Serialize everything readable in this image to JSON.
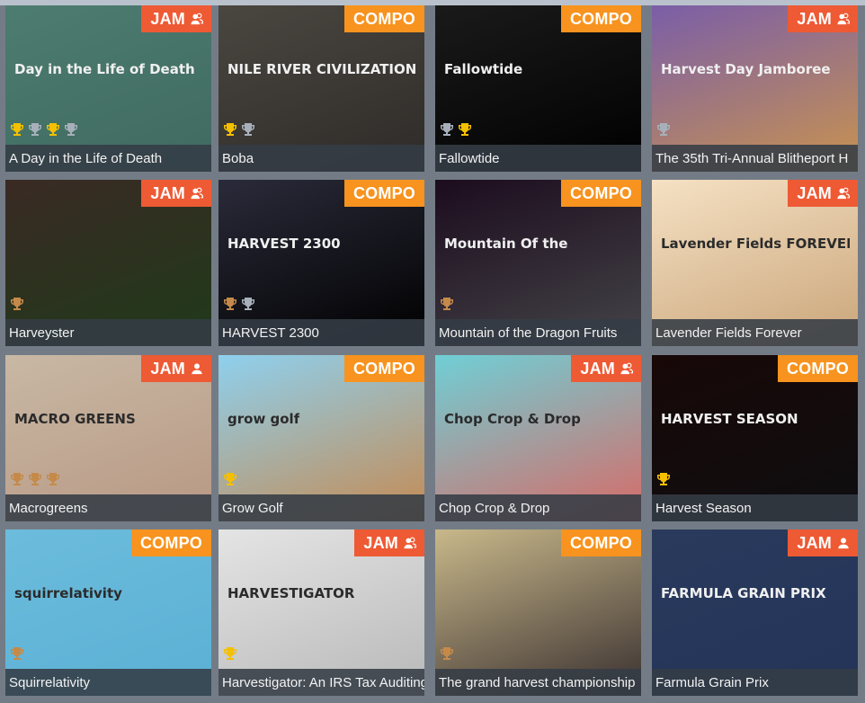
{
  "colors": {
    "background": "#737c86",
    "jam_badge": "#ee5a34",
    "compo_badge": "#f7931e",
    "gold": "#f5c000",
    "silver": "#a7b0ba",
    "bronze": "#c58a4a",
    "title_bar": "#343c46"
  },
  "games": [
    {
      "title": "A Day in the Life of Death",
      "category": "JAM",
      "team": true,
      "trophies": [
        "gold",
        "silver",
        "gold",
        "silver"
      ],
      "art": "Day in the Life of Death",
      "thumb": [
        "#4d7c70",
        "#3f6a60"
      ]
    },
    {
      "title": "Boba",
      "category": "COMPO",
      "team": false,
      "trophies": [
        "gold",
        "silver"
      ],
      "art": "NILE RIVER CIVILIZATION",
      "thumb": [
        "#4a4640",
        "#2e2b28"
      ]
    },
    {
      "title": "Fallowtide",
      "category": "COMPO",
      "team": false,
      "trophies": [
        "silver",
        "gold"
      ],
      "art": "Fallowtide",
      "thumb": [
        "#1a1a1a",
        "#000000"
      ]
    },
    {
      "title": "The 35th Tri-Annual Blitheport H",
      "category": "JAM",
      "team": true,
      "trophies": [
        "silver"
      ],
      "art": "Harvest Day Jamboree",
      "thumb": [
        "#7a5ea8",
        "#c9934f"
      ]
    },
    {
      "title": "Harveyster",
      "category": "JAM",
      "team": true,
      "trophies": [
        "bronze"
      ],
      "art": "",
      "thumb": [
        "#3a2a24",
        "#1f3a1a"
      ]
    },
    {
      "title": "HARVEST 2300",
      "category": "COMPO",
      "team": false,
      "trophies": [
        "bronze",
        "silver"
      ],
      "art": "HARVEST 2300",
      "thumb": [
        "#2a2a3a",
        "#000000"
      ]
    },
    {
      "title": "Mountain of the Dragon Fruits",
      "category": "COMPO",
      "team": false,
      "trophies": [
        "bronze"
      ],
      "art": "Mountain Of the",
      "thumb": [
        "#1c0c1e",
        "#444448"
      ]
    },
    {
      "title": "Lavender Fields Forever",
      "category": "JAM",
      "team": true,
      "trophies": [],
      "art": "Lavender Fields FOREVER",
      "thumb": [
        "#f5e1c4",
        "#caa57a"
      ]
    },
    {
      "title": "Macrogreens",
      "category": "JAM",
      "team": false,
      "trophies": [
        "bronze",
        "bronze",
        "bronze"
      ],
      "art": "MACRO GREENS",
      "thumb": [
        "#c8b8a4",
        "#b89884"
      ]
    },
    {
      "title": "Grow Golf",
      "category": "COMPO",
      "team": false,
      "trophies": [
        "gold"
      ],
      "art": "grow golf",
      "thumb": [
        "#8ed0ee",
        "#c58a52"
      ]
    },
    {
      "title": "Chop Crop & Drop",
      "category": "JAM",
      "team": true,
      "trophies": [],
      "art": "Chop Crop & Drop",
      "thumb": [
        "#6fcfd6",
        "#d86a66"
      ]
    },
    {
      "title": "Harvest Season",
      "category": "COMPO",
      "team": false,
      "trophies": [
        "gold"
      ],
      "art": "HARVEST SEASON",
      "thumb": [
        "#180808",
        "#0e0e10"
      ]
    },
    {
      "title": "Squirrelativity",
      "category": "COMPO",
      "team": false,
      "trophies": [
        "bronze"
      ],
      "art": "squirrelativity",
      "thumb": [
        "#6cbcdc",
        "#5ab0d4"
      ]
    },
    {
      "title": "Harvestigator: An IRS Tax Auditing",
      "category": "JAM",
      "team": true,
      "trophies": [
        "gold"
      ],
      "art": "HARVESTIGATOR",
      "thumb": [
        "#e4e4e4",
        "#b8b8b8"
      ]
    },
    {
      "title": "The grand harvest championship",
      "category": "COMPO",
      "team": false,
      "trophies": [
        "bronze"
      ],
      "art": "",
      "thumb": [
        "#c8b88a",
        "#3a3030"
      ]
    },
    {
      "title": "Farmula Grain Prix",
      "category": "JAM",
      "team": false,
      "trophies": [],
      "art": "FARMULA GRAIN PRIX",
      "thumb": [
        "#2a3a5c",
        "#24345a"
      ]
    }
  ]
}
